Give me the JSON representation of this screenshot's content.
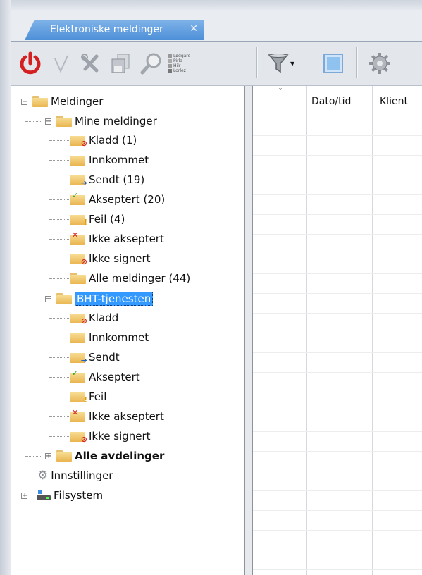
{
  "tab": {
    "label": "Elektroniske meldinger",
    "close": "✕"
  },
  "toolbar": {
    "power": "power-icon",
    "accept": "checkmark-icon",
    "reject": "tools-icon",
    "export": "save-icon",
    "search": "search-user-icon",
    "legend": [
      "Lødgard",
      "Pirla",
      "Hilr",
      "Lorlez"
    ],
    "filter": "funnel-icon",
    "dropdown": "▾",
    "view": "window-icon",
    "settings": "gear-icon"
  },
  "tree": {
    "root": "Meldinger",
    "mine": "Mine meldinger",
    "mine_items": [
      "Kladd (1)",
      "Innkommet",
      "Sendt (19)",
      "Akseptert (20)",
      "Feil (4)",
      "Ikke akseptert",
      "Ikke signert",
      "Alle meldinger (44)"
    ],
    "bht": "BHT-tjenesten",
    "bht_items": [
      "Kladd",
      "Innkommet",
      "Sendt",
      "Akseptert",
      "Feil",
      "Ikke akseptert",
      "Ikke signert"
    ],
    "alle": "Alle avdelinger",
    "innstillinger": "Innstillinger",
    "filsystem": "Filsystem",
    "expand": "+",
    "collapse": "−"
  },
  "grid": {
    "sort_glyph": "˅",
    "columns": [
      "Dato/tid",
      "Klient"
    ]
  },
  "colors": {
    "tab_blue": "#4d8fd8",
    "selection": "#3399ff",
    "power_red": "#d42020"
  }
}
